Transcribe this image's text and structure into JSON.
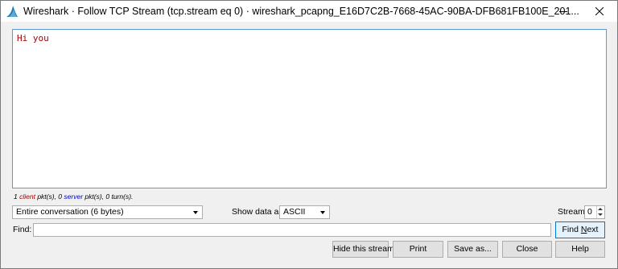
{
  "window": {
    "title": "Wireshark · Follow TCP Stream (tcp.stream eq 0) · wireshark_pcapng_E16D7C2B-7668-45AC-90BA-DFB681FB100E_201...",
    "minimize_glyph": "—",
    "close_glyph": "✕"
  },
  "stream": {
    "content": "Hi you"
  },
  "stats": {
    "client_count": "1",
    "client_word": "client",
    "middle": "pkt(s), 0",
    "server_word": "server",
    "end": "pkt(s), 0 turn(s)."
  },
  "conversation": {
    "selected": "Entire conversation (6 bytes)"
  },
  "show_data": {
    "label": "Show data as",
    "selected": "ASCII"
  },
  "stream_selector": {
    "label": "Stream",
    "value": "0"
  },
  "find": {
    "label": "Find:",
    "value": "",
    "button_prefix": "Find ",
    "button_underlined": "N",
    "button_suffix": "ext"
  },
  "buttons": {
    "hide": "Hide this stream",
    "print": "Print",
    "save": "Save as...",
    "close": "Close",
    "help": "Help"
  },
  "colors": {
    "client": "#a50000",
    "server": "#0000b4",
    "focus_border": "#5b9bd5"
  }
}
